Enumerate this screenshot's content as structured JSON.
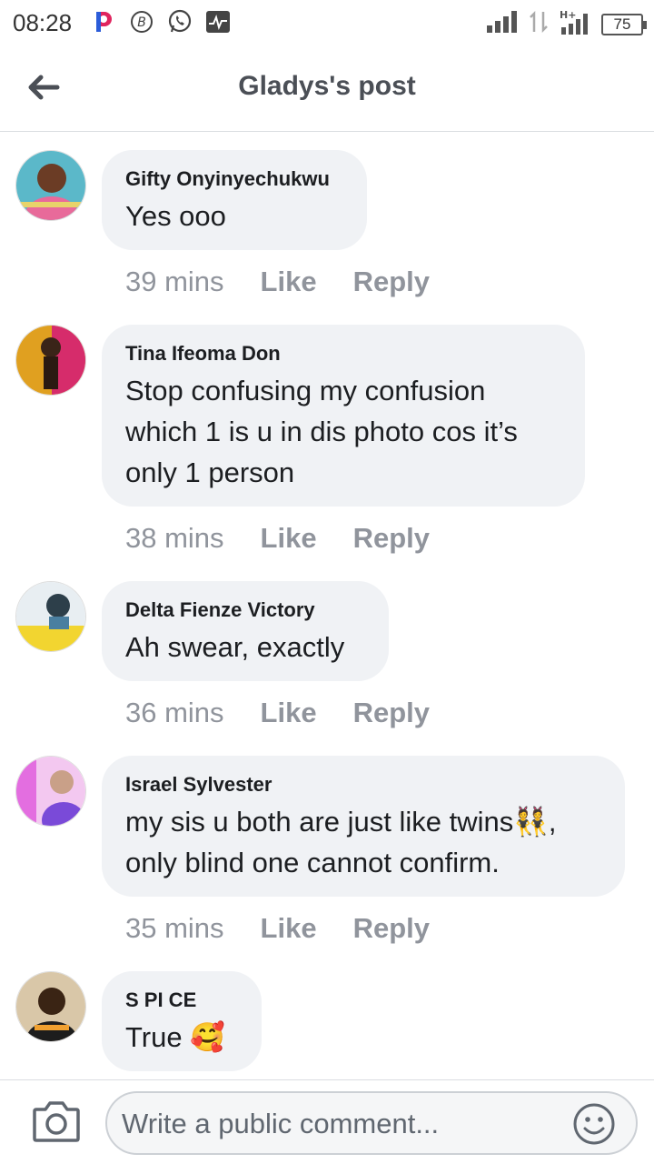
{
  "status_bar": {
    "time": "08:28",
    "battery": "75",
    "network": "H+"
  },
  "header": {
    "title": "Gladys's post"
  },
  "comments": [
    {
      "name": "Gifty Onyinyechukwu",
      "text": "Yes ooo",
      "time": "39 mins",
      "like": "Like",
      "reply": "Reply",
      "avatar_color": "#5bb8c9"
    },
    {
      "name": "Tina Ifeoma Don",
      "text_lines": [
        "Stop confusing my confusion",
        "which 1 is u in dis photo cos it’s",
        "only 1 person"
      ],
      "time": "38 mins",
      "like": "Like",
      "reply": "Reply",
      "avatar_color": "#e0a020"
    },
    {
      "name": "Delta Fienze Victory",
      "text": "Ah swear, exactly",
      "time": "36 mins",
      "like": "Like",
      "reply": "Reply",
      "avatar_color": "#f2d530"
    },
    {
      "name": "Israel Sylvester",
      "text_lines": [
        "my sis u both are just like twins👯,",
        "only blind one cannot confirm."
      ],
      "time": "35 mins",
      "like": "Like",
      "reply": "Reply",
      "avatar_color": "#c56ce0"
    },
    {
      "name": "S PI CE",
      "text": "True 🥰",
      "avatar_color": "#8a5a32"
    }
  ],
  "composer": {
    "placeholder": "Write a public comment..."
  },
  "colors": {
    "bubble": "#f0f2f5",
    "meta": "#90949c",
    "title": "#4b4f56"
  }
}
